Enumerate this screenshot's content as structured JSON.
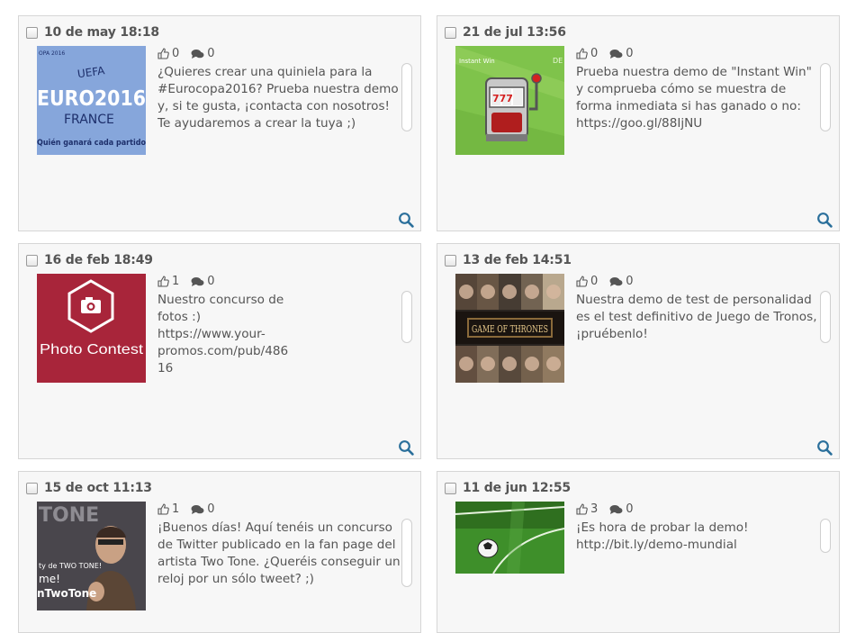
{
  "posts": [
    {
      "date": "10 de may 18:18",
      "likes": "0",
      "comments": "0",
      "text": "¿Quieres crear una quiniela para la #Eurocopa2016? Prueba nuestra demo y, si te gusta, ¡contacta con nosotros! Te ayudaremos a crear la tuya ;)",
      "thumb": {
        "corner": "OPA 2016",
        "org": "UEFA",
        "main": "EURO2016",
        "sub": "FRANCE",
        "bottom": "Quién ganará cada partido"
      }
    },
    {
      "date": "21 de jul 13:56",
      "likes": "0",
      "comments": "0",
      "text": "Prueba nuestra demo de \"Instant Win\" y comprueba cómo se muestra de forma inmediata si has ganado o no: https://goo.gl/88IjNU",
      "thumb": {
        "corner": "Instant Win",
        "corner_right": "DE"
      }
    },
    {
      "date": "16 de feb 18:49",
      "likes": "1",
      "comments": "0",
      "text": "Nuestro concurso de fotos :) https://www.your-promos.com/pub/48616",
      "thumb": {
        "label": "Photo Contest"
      }
    },
    {
      "date": "13 de feb 14:51",
      "likes": "0",
      "comments": "0",
      "text": "Nuestra demo de test de personalidad es el test definitivo de Juego de Tronos, ¡pruébenlo!",
      "thumb": {
        "label": "GAME OF THRONES"
      }
    },
    {
      "date": "15 de oct 11:13",
      "likes": "1",
      "comments": "0",
      "text": "¡Buenos días! Aquí tenéis un concurso de Twitter publicado en la fan page del artista Two Tone. ¿Queréis conseguir un reloj por un sólo tweet? ;)",
      "thumb": {
        "top": "TONE",
        "mid1": "ty de TWO TONE!",
        "mid2": "me!",
        "bottom": "nTwoTone"
      }
    },
    {
      "date": "11 de jun 12:55",
      "likes": "3",
      "comments": "0",
      "text": "¡Es hora de probar la demo! http://bit.ly/demo-mundial",
      "thumb": {}
    }
  ],
  "colors": {
    "zoom": "#2a6f9b",
    "card_bg": "#f7f7f7",
    "card_border": "#d6d6d6"
  },
  "icons": {
    "like": "thumbs-up-icon",
    "comments": "comments-icon",
    "view": "search-icon"
  }
}
